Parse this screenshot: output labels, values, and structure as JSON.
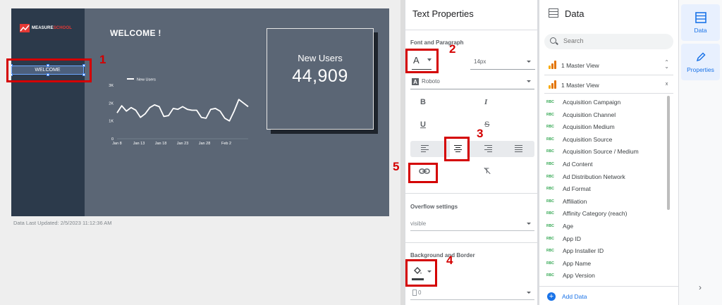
{
  "report": {
    "logo_text_main": "MEASURE",
    "logo_text_accent": "SCHOOL",
    "welcome_box_label": "WELCOME",
    "welcome_title": "WELCOME !",
    "last_updated": "Data Last Updated: 2/5/2023 11:12:36 AM"
  },
  "chart_data": {
    "type": "line",
    "legend": "New Users",
    "legend_position": "top-left",
    "x_ticks": [
      "Jan 8",
      "Jan 13",
      "Jan 18",
      "Jan 23",
      "Jan 28",
      "Feb 2"
    ],
    "y_ticks": [
      "0",
      "1K",
      "2K",
      "3K"
    ],
    "ylim": [
      0,
      3000
    ],
    "series": [
      {
        "name": "New Users",
        "x": [
          0,
          1,
          2,
          3,
          4,
          5,
          6,
          7,
          8,
          9,
          10,
          11,
          12,
          13,
          14,
          15,
          16,
          17,
          18,
          19,
          20,
          21,
          22,
          23,
          24,
          25,
          26,
          27,
          28
        ],
        "values": [
          1450,
          1850,
          1550,
          1750,
          1600,
          1200,
          1400,
          1750,
          1900,
          1800,
          1250,
          1300,
          1700,
          1650,
          1800,
          1650,
          1600,
          1600,
          1200,
          1150,
          1650,
          1700,
          1550,
          1150,
          1000,
          1550,
          2200,
          2000,
          1800
        ],
        "color": "#ffffff"
      }
    ]
  },
  "scorecard": {
    "label": "New Users",
    "value": "44,909"
  },
  "text_properties": {
    "title": "Text Properties",
    "font_section": "Font and Paragraph",
    "font_color_glyph": "A",
    "font_size": "14px",
    "font_family_glyph": "A",
    "font_family": "Roboto",
    "bold_glyph": "B",
    "italic_glyph": "I",
    "underline_glyph": "U",
    "strike_glyph": "S",
    "clear_glyph": "T",
    "overflow_label": "Overflow settings",
    "overflow_value": "visible",
    "background_label": "Background and Border",
    "border_weight": "0"
  },
  "annotations": [
    "1",
    "2",
    "3",
    "4",
    "5"
  ],
  "data_panel": {
    "title": "Data",
    "search_placeholder": "Search",
    "sources": [
      "1 Master View",
      "1 Master View"
    ],
    "field_type_label": "RBC",
    "fields": [
      "Acquisition Campaign",
      "Acquisition Channel",
      "Acquisition Medium",
      "Acquisition Source",
      "Acquisition Source / Medium",
      "Ad Content",
      "Ad Distribution Network",
      "Ad Format",
      "Affiliation",
      "Affinity Category (reach)",
      "Age",
      "App ID",
      "App Installer ID",
      "App Name",
      "App Version"
    ],
    "add_data": "Add Data"
  },
  "rail": {
    "data_label": "Data",
    "properties_label": "Properties",
    "collapse_glyph": "›"
  },
  "colors": {
    "annotation": "#d40000",
    "accent": "#1a73e8",
    "report_bg": "#5b6675",
    "sidebar_bg": "#2c3a4b"
  }
}
